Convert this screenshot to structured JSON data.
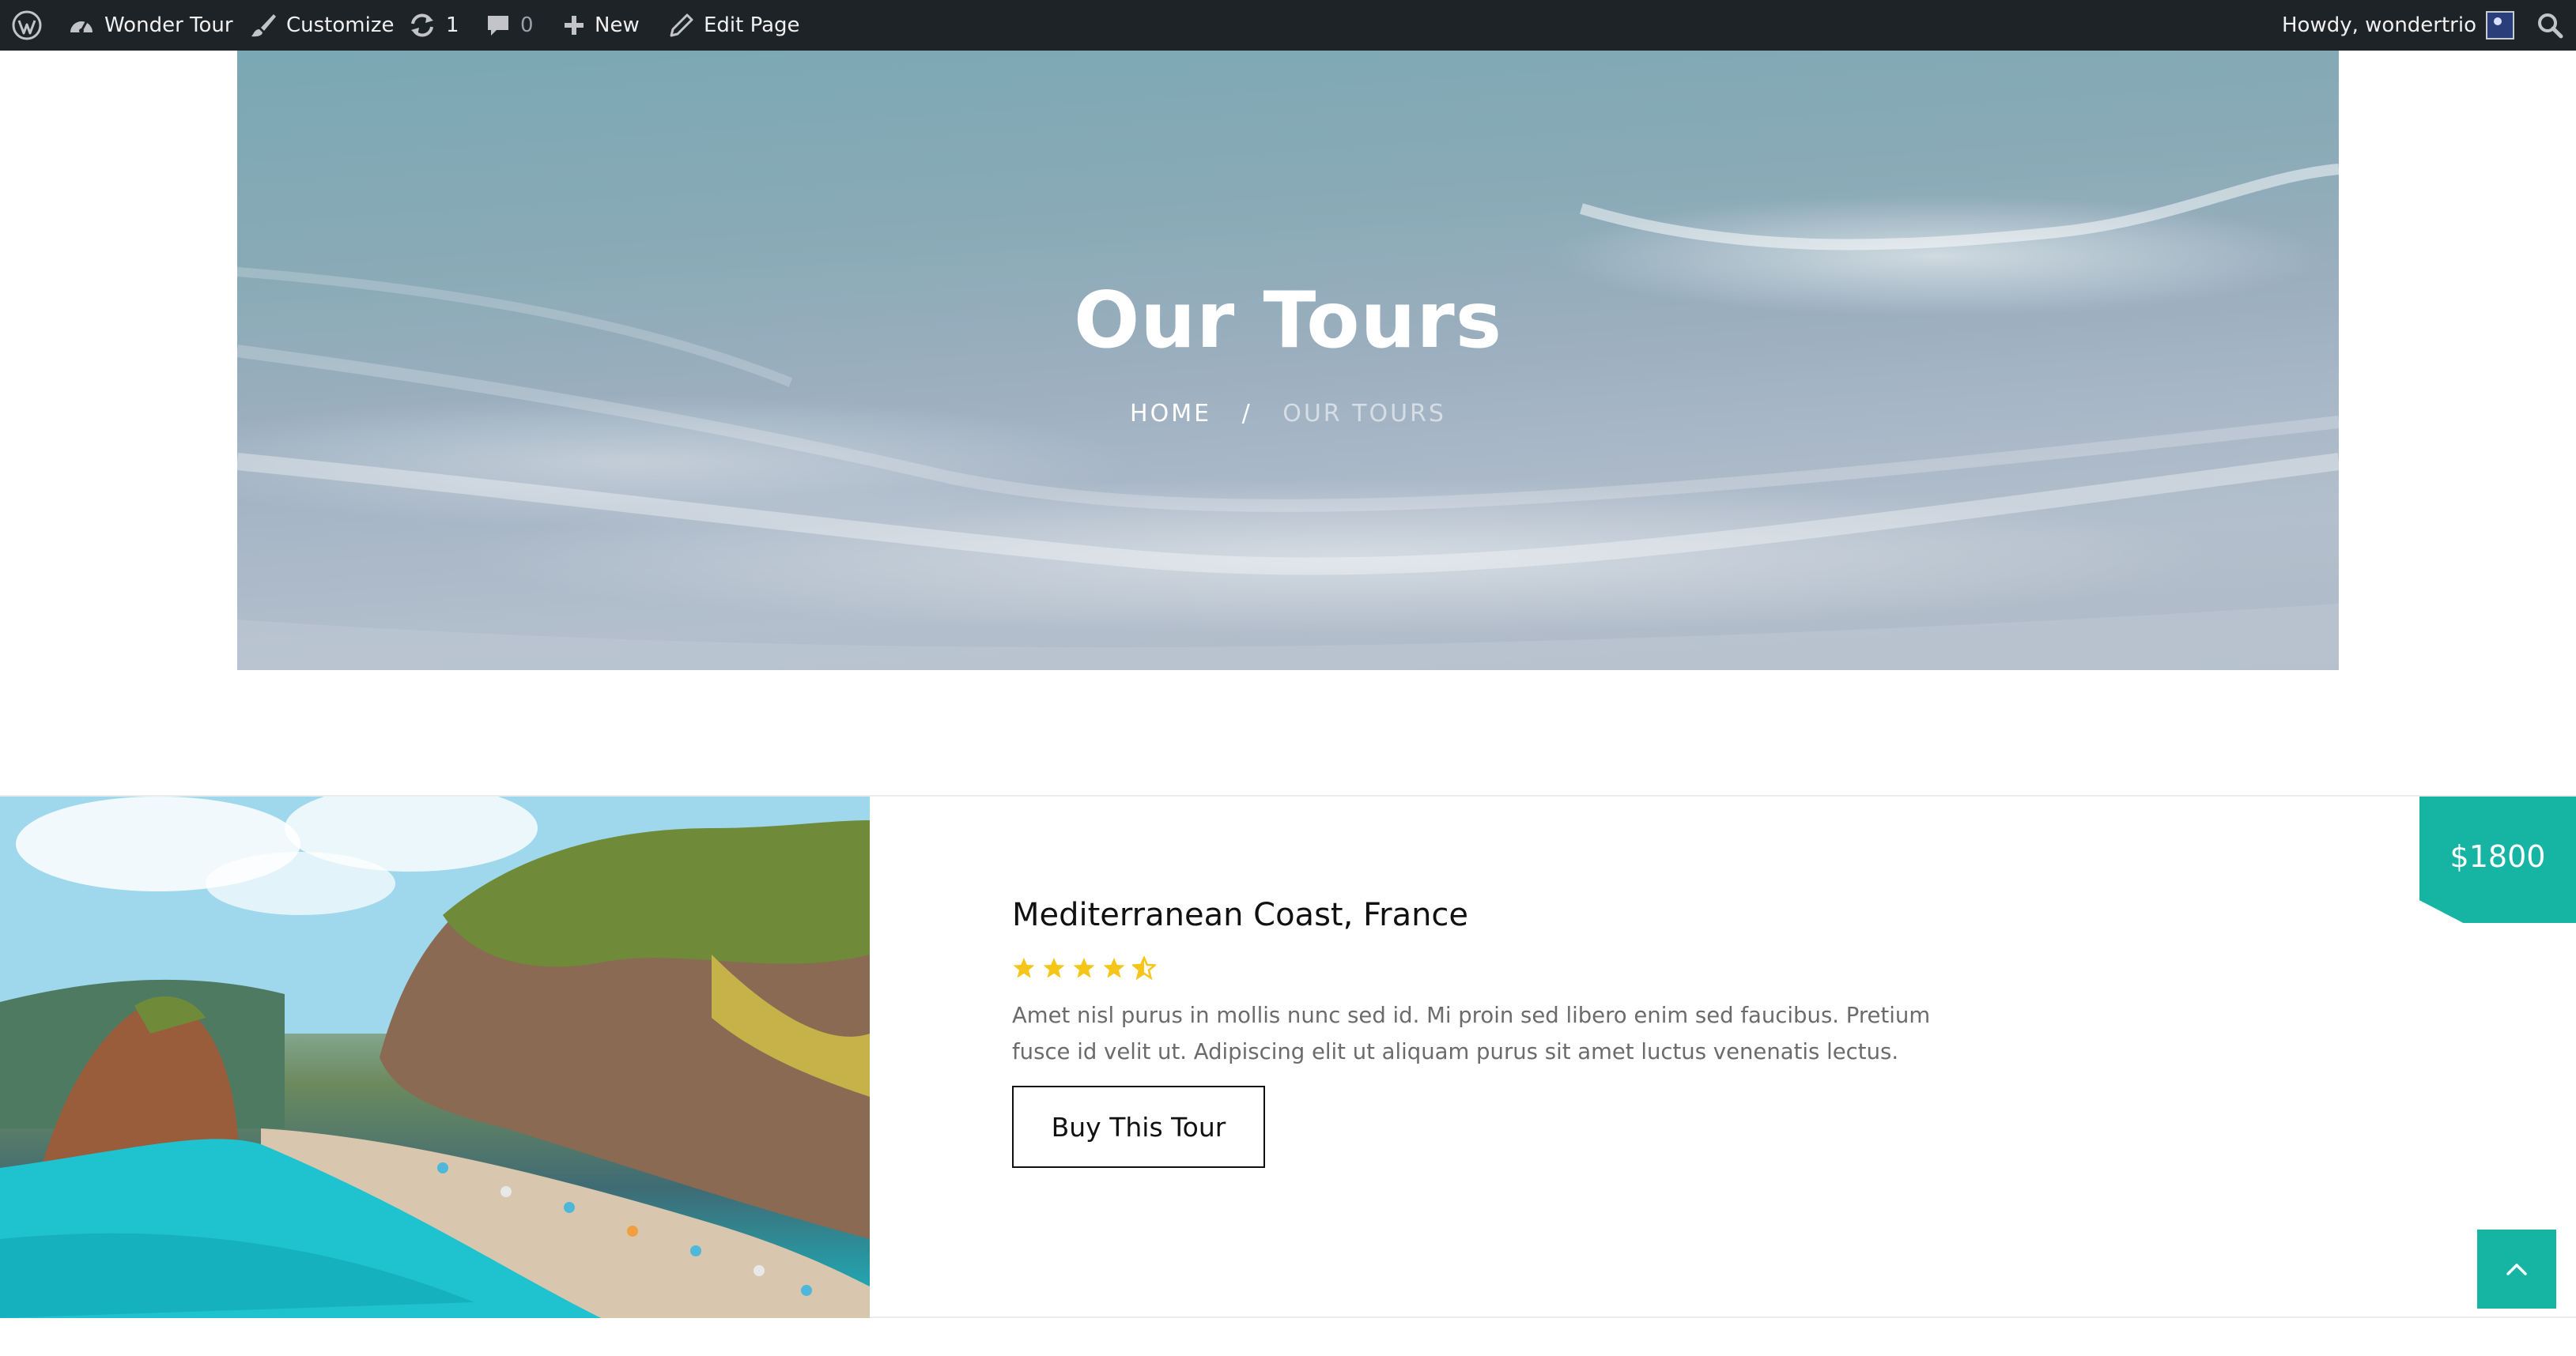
{
  "admin_bar": {
    "site_name": "Wonder Tour",
    "customize": "Customize",
    "updates_count": "1",
    "comments_count": "0",
    "new_label": "New",
    "edit_page": "Edit Page",
    "howdy": "Howdy, wondertrio",
    "icons": [
      "wordpress-logo-icon",
      "dashboard-icon",
      "brush-icon",
      "refresh-icon",
      "comment-icon",
      "plus-icon",
      "pencil-icon",
      "avatar",
      "search-icon"
    ]
  },
  "hero": {
    "title": "Our Tours",
    "breadcrumb": {
      "home": "HOME",
      "separator": "/",
      "current": "OUR TOURS"
    }
  },
  "tour": {
    "title": "Mediterranean Coast, France",
    "rating": 4.5,
    "rating_max": 5,
    "description_lines": [
      "Amet nisl purus in mollis nunc sed id. Mi proin sed libero enim sed faucibus. Pretium",
      "fusce id velit ut. Adipiscing elit ut aliquam purus sit amet luctus venenatis lectus."
    ],
    "button_label": "Buy This Tour",
    "price": "$1800"
  },
  "colors": {
    "accent": "#16b5a3",
    "admin_bar_bg": "#1d2327",
    "star": "#f5c518",
    "text_dark": "#111111",
    "text_muted": "#6b6b6b"
  },
  "back_to_top": {
    "icon": "chevron-up-icon"
  }
}
